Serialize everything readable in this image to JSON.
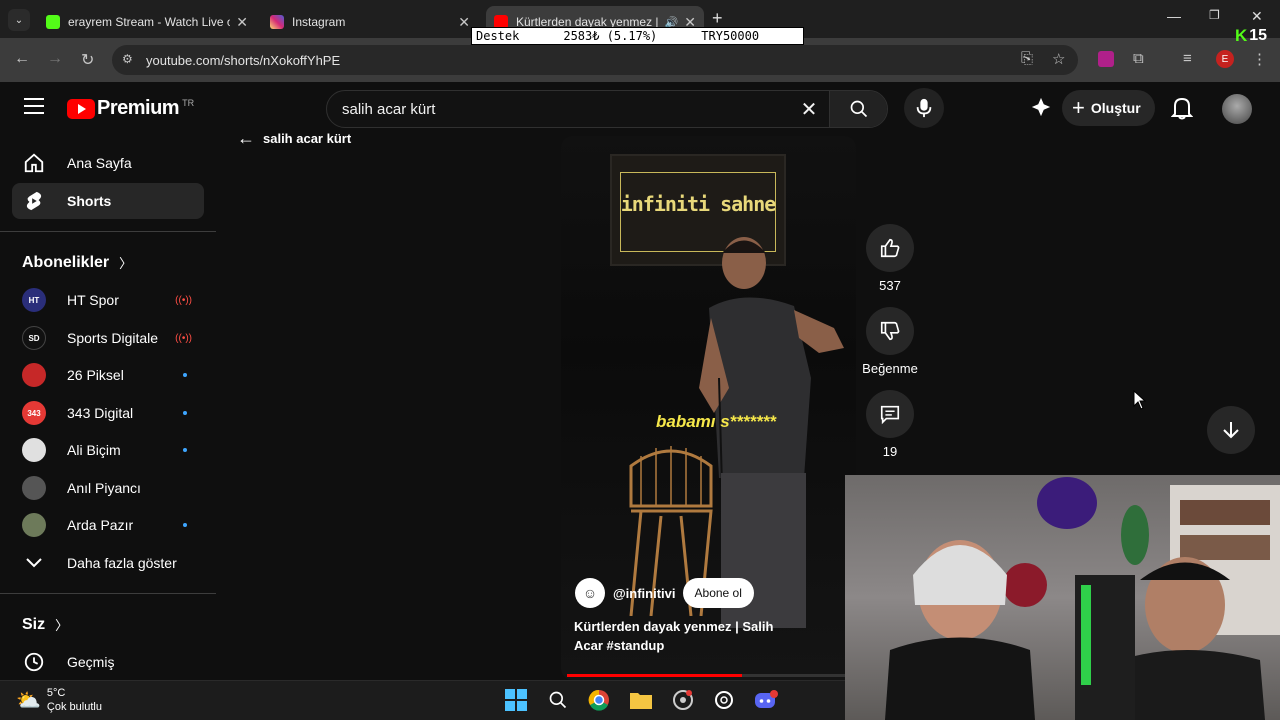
{
  "browser": {
    "tabs": [
      {
        "title": "erayrem Stream - Watch Live o",
        "favicon_color": "#53fc18"
      },
      {
        "title": "Instagram",
        "favicon_color": "#d6249f"
      },
      {
        "title": "Kürtlerden dayak yenmez |",
        "favicon_color": "#ff0000"
      }
    ],
    "url": "youtube.com/shorts/nXokoffYhPE",
    "profile_initial": "E"
  },
  "overlay": {
    "ticker_label": "Destek",
    "ticker_value": "2583₺ (5.17%)",
    "ticker_goal": "TRY50000",
    "goal_progress_percent": 5.17,
    "badge_letter": "K",
    "badge_count": "15"
  },
  "youtube": {
    "logo_text": "Premium",
    "logo_country": "TR",
    "search": {
      "value": "salih acar kürt"
    },
    "create_label": "Oluştur",
    "back_label": "salih acar kürt"
  },
  "sidebar": {
    "main": [
      {
        "label": "Ana Sayfa",
        "icon": "home-icon"
      },
      {
        "label": "Shorts",
        "icon": "shorts-icon",
        "selected": true
      }
    ],
    "subscriptions_title": "Abonelikler",
    "channels": [
      {
        "name": "HT Spor",
        "avatar_text": "HT",
        "avatar_color": "#2a2e7a",
        "status": "live"
      },
      {
        "name": "Sports Digitale",
        "avatar_text": "SD",
        "avatar_color": "#111111",
        "status": "live"
      },
      {
        "name": "26 Piksel",
        "avatar_text": "",
        "avatar_color": "#c62828",
        "status": "new"
      },
      {
        "name": "343 Digital",
        "avatar_text": "343",
        "avatar_color": "#e53935",
        "status": "new"
      },
      {
        "name": "Ali Biçim",
        "avatar_text": "",
        "avatar_color": "#e0e0e0",
        "status": "new"
      },
      {
        "name": "Anıl Piyancı",
        "avatar_text": "",
        "avatar_color": "#555555",
        "status": "none"
      },
      {
        "name": "Arda Pazır",
        "avatar_text": "",
        "avatar_color": "#6d7a5a",
        "status": "new"
      }
    ],
    "show_more_label": "Daha fazla göster",
    "you_title": "Siz",
    "history_label": "Geçmiş"
  },
  "short": {
    "sign_text": "infiniti sahne",
    "caption": "babamı s*******",
    "channel_handle": "@infinitivi",
    "subscribe_label": "Abone ol",
    "title": "Kürtlerden dayak yenmez | Salih Acar #standup",
    "likes": "537",
    "dislike_label": "Beğenme",
    "comments": "19",
    "progress_fraction": 0.62
  },
  "taskbar": {
    "temperature": "5°C",
    "condition": "Çok bulutlu"
  },
  "colors": {
    "accent": "#ff0000",
    "background": "#0f0f0f",
    "live": "#ff4e45",
    "new_dot": "#3ea6ff"
  }
}
